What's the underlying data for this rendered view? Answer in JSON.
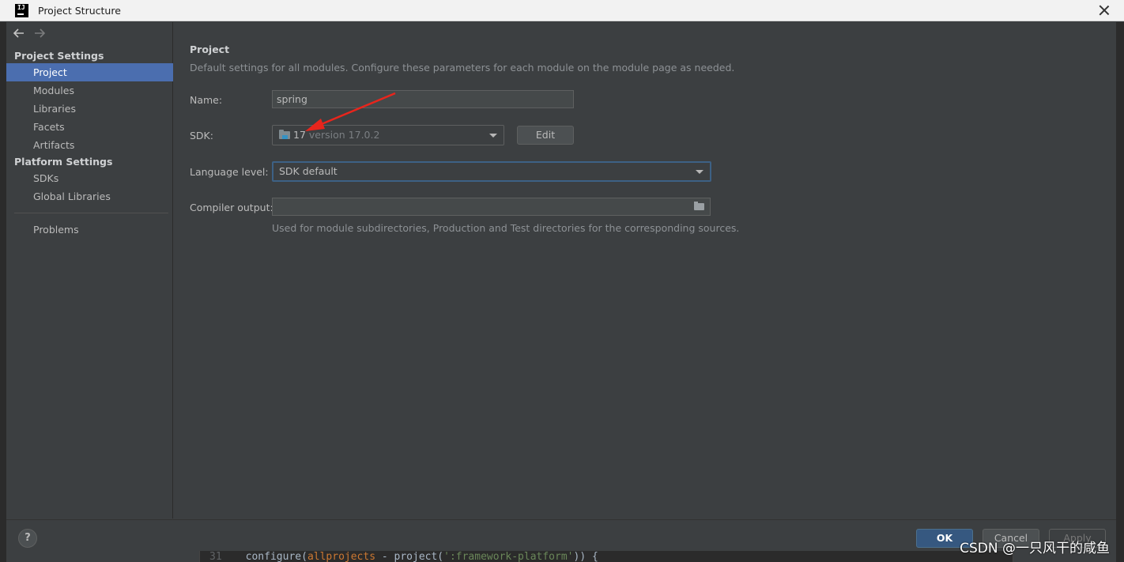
{
  "window": {
    "title": "Project Structure"
  },
  "sidebar": {
    "project_settings_label": "Project Settings",
    "project_items": [
      {
        "label": "Project",
        "selected": true
      },
      {
        "label": "Modules"
      },
      {
        "label": "Libraries"
      },
      {
        "label": "Facets"
      },
      {
        "label": "Artifacts"
      }
    ],
    "platform_settings_label": "Platform Settings",
    "platform_items": [
      {
        "label": "SDKs"
      },
      {
        "label": "Global Libraries"
      }
    ],
    "problems_label": "Problems"
  },
  "main": {
    "heading": "Project",
    "subheading": "Default settings for all modules. Configure these parameters for each module on the module page as needed.",
    "name_label": "Name:",
    "name_value": "spring",
    "sdk_label": "SDK:",
    "sdk_name": "17",
    "sdk_version": "version 17.0.2",
    "edit_button": "Edit",
    "language_level_label": "Language level:",
    "language_level_value": "SDK default",
    "compiler_output_label": "Compiler output:",
    "compiler_output_value": "",
    "compiler_output_hint": "Used for module subdirectories, Production and Test directories for the corresponding sources."
  },
  "buttons": {
    "help": "?",
    "ok": "OK",
    "cancel": "Cancel",
    "apply": "Apply"
  },
  "editor_bleed": {
    "line_number": "31",
    "code_prefix": "configure(",
    "code_keyword": "allprojects",
    "code_middle": " - project(",
    "code_string": "':framework-platform'",
    "code_suffix": ")) {"
  },
  "watermark": "CSDN @一只风干的咸鱼",
  "colors": {
    "selection": "#4b6eaf",
    "background": "#3c3f41",
    "ok_button": "#365880",
    "annotation_arrow": "#e8251c",
    "focus_border": "#3d6185"
  },
  "icons": {
    "back": "arrow-left-icon",
    "forward": "arrow-right-icon",
    "close": "close-icon",
    "sdk": "folder-icon",
    "browse": "folder-icon",
    "help": "help-icon"
  }
}
